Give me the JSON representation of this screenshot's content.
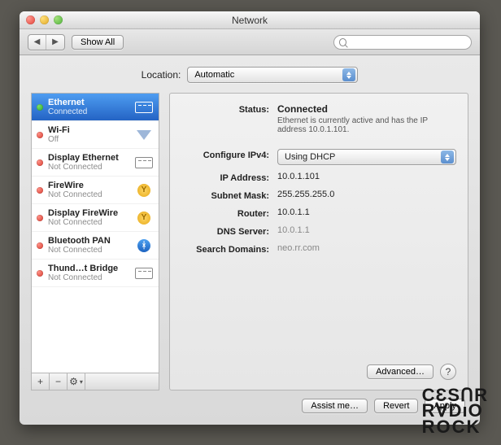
{
  "window": {
    "title": "Network"
  },
  "toolbar": {
    "show_all": "Show All",
    "search_placeholder": ""
  },
  "location": {
    "label": "Location:",
    "value": "Automatic"
  },
  "sidebar": {
    "items": [
      {
        "name": "Ethernet",
        "state": "Connected",
        "status": "green",
        "icon": "ethernet",
        "selected": true
      },
      {
        "name": "Wi-Fi",
        "state": "Off",
        "status": "red",
        "icon": "wifi",
        "selected": false
      },
      {
        "name": "Display Ethernet",
        "state": "Not Connected",
        "status": "red",
        "icon": "ethernet",
        "selected": false
      },
      {
        "name": "FireWire",
        "state": "Not Connected",
        "status": "red",
        "icon": "firewire",
        "selected": false
      },
      {
        "name": "Display FireWire",
        "state": "Not Connected",
        "status": "red",
        "icon": "firewire",
        "selected": false
      },
      {
        "name": "Bluetooth PAN",
        "state": "Not Connected",
        "status": "red",
        "icon": "bluetooth",
        "selected": false
      },
      {
        "name": "Thund…t Bridge",
        "state": "Not Connected",
        "status": "red",
        "icon": "ethernet",
        "selected": false
      }
    ],
    "footer": {
      "add": "+",
      "remove": "−",
      "action": "⚙"
    }
  },
  "details": {
    "status_label": "Status:",
    "status_value": "Connected",
    "status_desc": "Ethernet is currently active and has the IP address 10.0.1.101.",
    "configure_label": "Configure IPv4:",
    "configure_value": "Using DHCP",
    "ip_label": "IP Address:",
    "ip_value": "10.0.1.101",
    "subnet_label": "Subnet Mask:",
    "subnet_value": "255.255.255.0",
    "router_label": "Router:",
    "router_value": "10.0.1.1",
    "dns_label": "DNS Server:",
    "dns_value": "10.0.1.1",
    "search_label": "Search Domains:",
    "search_value": "neo.rr.com",
    "advanced": "Advanced…",
    "help": "?"
  },
  "bottom": {
    "assist": "Assist me…",
    "revert": "Revert",
    "apply": "Apply"
  },
  "watermark": {
    "l1": "CƐSՈR",
    "l2": "RⱯDıO",
    "l3": "ROCK"
  }
}
